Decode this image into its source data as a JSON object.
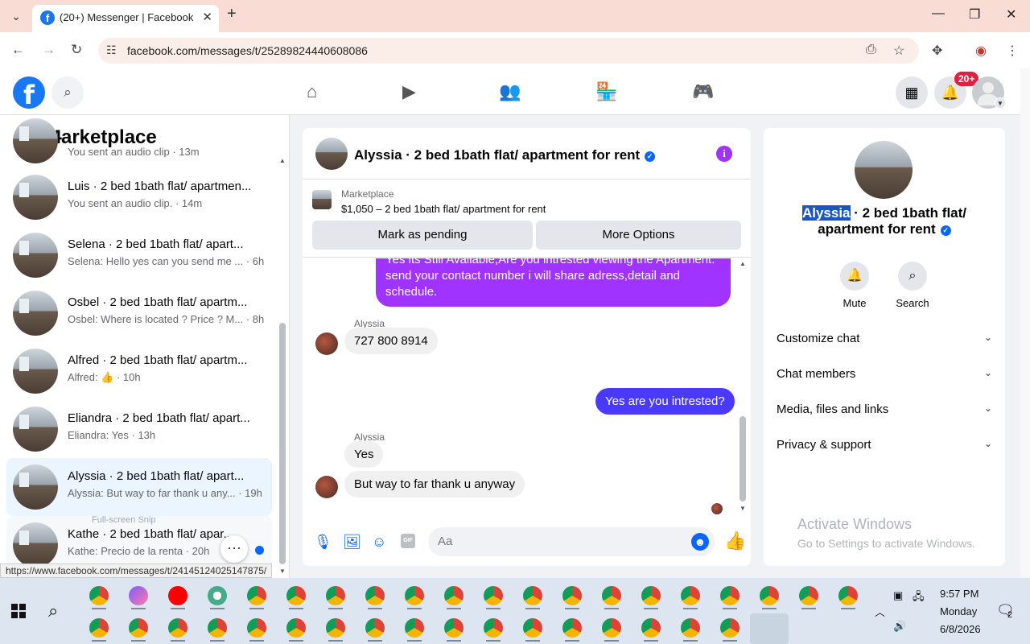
{
  "browser": {
    "tab_title": "(20+) Messenger | Facebook",
    "tab_favicon": "f",
    "url": "facebook.com/messages/t/25289824440608086",
    "status_link": "https://www.facebook.com/messages/t/24145124025147875/"
  },
  "fb": {
    "notif_count": "20+"
  },
  "sidebar": {
    "title": "Marketplace",
    "partial_snippet": "You sent an audio clip · 13m",
    "conversations": [
      {
        "name": "Luis · 2 bed 1bath flat/ apartmen...",
        "snippet": "You sent an audio clip. · 14m"
      },
      {
        "name": "Selena · 2 bed 1bath flat/ apart...",
        "snippet": "Selena: Hello yes can you send me ... · 6h"
      },
      {
        "name": "Osbel · 2 bed 1bath flat/ apartm...",
        "snippet": "Osbel: Where is located ? Price ? M... · 8h"
      },
      {
        "name": "Alfred · 2 bed 1bath flat/ apartm...",
        "snippet": "Alfred: 👍 · 10h"
      },
      {
        "name": "Eliandra · 2 bed 1bath flat/ apart...",
        "snippet": "Eliandra: Yes · 13h"
      },
      {
        "name": "Alyssia · 2 bed 1bath flat/ apart...",
        "snippet": "Alyssia: But way to far thank u any... · 19h"
      },
      {
        "name": "Kathe · 2 bed 1bath flat/ apar...",
        "snippet": "Kathe: Precio de la renta · 20h"
      }
    ],
    "snip_tooltip": "Full-screen Snip",
    "more_label": "···"
  },
  "chat": {
    "title": "Alyssia · 2 bed 1bath flat/ apartment for rent",
    "marketplace_label": "Marketplace",
    "listing": "$1,050 – 2 bed 1bath flat/ apartment for rent",
    "mark_pending": "Mark as pending",
    "more_options": "More Options",
    "messages": {
      "out1_line1": "Yes its Still Available,Are you intrested viewing the Apartment.",
      "out1_line2": "send your contact number i will share adress,detail and",
      "out1_line3": "schedule.",
      "sender1": "Alyssia",
      "in1": "727 800 8914",
      "out2": "Yes are you intrested?",
      "sender2": "Alyssia",
      "in2": "Yes",
      "in3": "But way to far thank u anyway"
    },
    "composer_placeholder": "Aa",
    "gif_label": "GIF"
  },
  "info_panel": {
    "name_highlight": "Alyssia",
    "name_rest": " · 2 bed 1bath flat/ apartment for rent",
    "mute": "Mute",
    "search": "Search",
    "rows": [
      "Customize chat",
      "Chat members",
      "Media, files and links",
      "Privacy & support"
    ],
    "watermark_1": "Activate Windows",
    "watermark_2": "Go to Settings to activate Windows."
  },
  "taskbar": {
    "time": "9:57 PM",
    "day": "Monday",
    "date": "6/8/2026",
    "notif_count": "2"
  }
}
